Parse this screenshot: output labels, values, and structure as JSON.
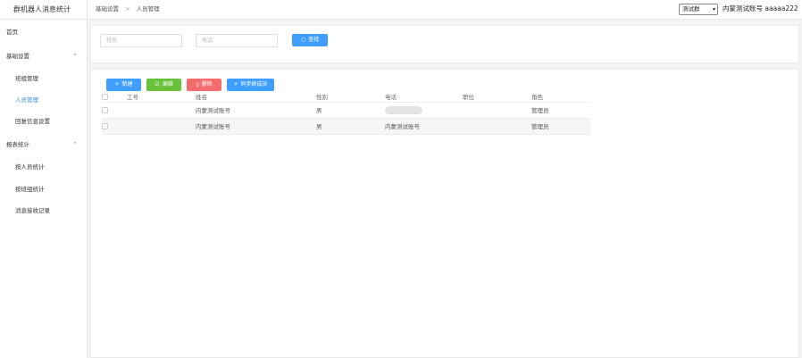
{
  "app": {
    "title": "群机器人消息统计"
  },
  "sidebar": {
    "items": [
      {
        "label": "首页"
      },
      {
        "label": "基础设置"
      },
      {
        "label": "班组管理"
      },
      {
        "label": "人员管理"
      },
      {
        "label": "回复信息设置"
      },
      {
        "label": "报表统计"
      },
      {
        "label": "按人员统计"
      },
      {
        "label": "按班组统计"
      },
      {
        "label": "消息接收记录"
      }
    ]
  },
  "header": {
    "breadcrumb": [
      "基础设置",
      ">",
      "人员管理"
    ],
    "group_select": "测试群",
    "account": "内蒙测试账号 aaaaa222"
  },
  "search": {
    "name_placeholder": "姓名",
    "phone_placeholder": "电话",
    "search_label": "查找"
  },
  "toolbar": {
    "add_label": "新建",
    "edit_label": "编辑",
    "delete_label": "删除",
    "sync_label": "同步群成员"
  },
  "table": {
    "columns": [
      "工号",
      "姓名",
      "性别",
      "电话",
      "职位",
      "角色"
    ],
    "rows": [
      {
        "id": "",
        "name": "内蒙测试账号",
        "gender": "男",
        "phone": "",
        "position": "",
        "role": "管理员"
      },
      {
        "id": "",
        "name": "内蒙测试账号",
        "gender": "男",
        "phone": "内蒙测试账号",
        "position": "",
        "role": "管理员"
      }
    ]
  },
  "colors": {
    "primary": "#409eff",
    "success": "#67c23a",
    "danger": "#f56c6c",
    "active_nav": "#3a8ee6"
  }
}
